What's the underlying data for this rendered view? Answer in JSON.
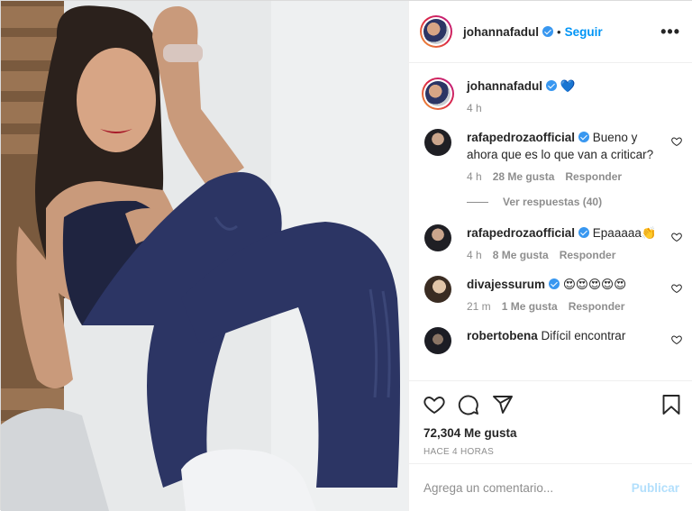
{
  "header": {
    "username": "johannafadul",
    "separator": "•",
    "follow_label": "Seguir",
    "more_label": "•••"
  },
  "caption": {
    "username": "johannafadul",
    "text": "💙",
    "time": "4 h"
  },
  "comments": [
    {
      "username": "rafapedrozaofficial",
      "text": "Bueno y ahora que es lo que van a criticar?",
      "time": "4 h",
      "likes": "28 Me gusta",
      "reply": "Responder",
      "replies": "Ver respuestas (40)"
    },
    {
      "username": "rafapedrozaofficial",
      "text": "Epaaaaa👏",
      "time": "4 h",
      "likes": "8 Me gusta",
      "reply": "Responder"
    },
    {
      "username": "divajessurum",
      "text": "😍😍😍😍😍",
      "time": "21 m",
      "likes": "1 Me gusta",
      "reply": "Responder"
    },
    {
      "username": "robertobena",
      "text": "Difícil encontrar"
    }
  ],
  "actions": {
    "likes": "72,304 Me gusta",
    "timestamp": "HACE 4 HORAS"
  },
  "add_comment": {
    "placeholder": "Agrega un comentario...",
    "publish_label": "Publicar"
  },
  "colors": {
    "accent": "#0095f6",
    "verified": "#3897f0",
    "muted": "#8e8e8e",
    "leggings": "#2c3564"
  },
  "icons": [
    "heart-icon",
    "comment-icon",
    "share-icon",
    "bookmark-icon",
    "verified-badge-icon",
    "more-options-icon"
  ]
}
